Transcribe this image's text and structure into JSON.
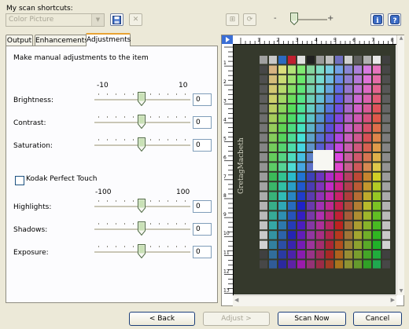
{
  "shortcuts": {
    "label": "My scan shortcuts:",
    "selected": "Color Picture"
  },
  "toolbar": {
    "save_icon": "floppy-disk-icon",
    "delete_icon": "delete-x-icon",
    "zoom_minus": "-",
    "zoom_plus": "+",
    "zoom_level": 0.1,
    "info_icon": "info-icon",
    "help_icon": "help-icon",
    "help_label": "?"
  },
  "tabs": [
    {
      "label": "Output"
    },
    {
      "label": "Enhancements"
    },
    {
      "label": "Adjustments"
    }
  ],
  "adjustments": {
    "heading": "Make manual adjustments to the item",
    "scale1_min": "-10",
    "scale1_max": "10",
    "brightness": {
      "label": "Brightness:",
      "value": "0"
    },
    "contrast": {
      "label": "Contrast:",
      "value": "0"
    },
    "saturation": {
      "label": "Saturation:",
      "value": "0"
    },
    "perfect_touch": {
      "label": "Kodak Perfect Touch",
      "checked": false
    },
    "scale2_min": "-100",
    "scale2_max": "100",
    "highlights": {
      "label": "Highlights:",
      "value": "0"
    },
    "shadows": {
      "label": "Shadows:",
      "value": "0"
    },
    "exposure": {
      "label": "Exposure:",
      "value": "0"
    }
  },
  "preview": {
    "ruler_top": [
      "1",
      "2",
      "3",
      "4",
      "5",
      "6",
      "7",
      "8"
    ],
    "ruler_left": [
      "1",
      "2",
      "3",
      "4",
      "5",
      "6",
      "7",
      "8",
      "9",
      "10",
      "11",
      "12",
      "13"
    ],
    "target_brand": "GretagMacbeth"
  },
  "buttons": {
    "back": "< Back",
    "adjust": "Adjust >",
    "scan_now": "Scan Now",
    "cancel": "Cancel"
  },
  "colors": {
    "accent": "#e8a233",
    "button_border": "#1c3e78",
    "scan_bg": "#35392c"
  }
}
